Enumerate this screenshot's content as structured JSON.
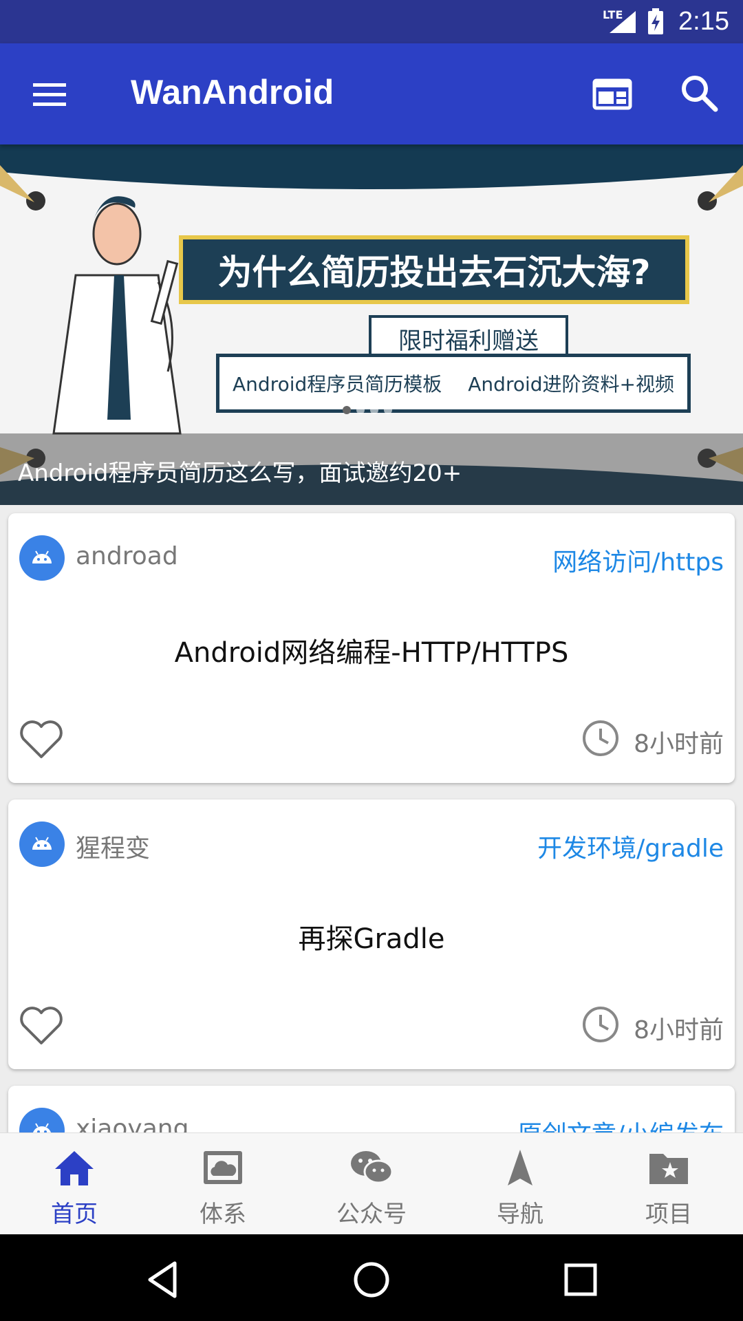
{
  "status_bar": {
    "network": "LTE",
    "time": "2:15"
  },
  "app_bar": {
    "title": "WanAndroid"
  },
  "banner": {
    "headline": "为什么简历投出去石沉大海?",
    "subheadline": "限时福利赠送",
    "tag_1": "Android程序员简历模板",
    "tag_2": "Android进阶资料+视频",
    "caption": "Android程序员简历这么写，面试邀约20+",
    "page_count": 4,
    "current_page": 1
  },
  "articles": [
    {
      "author": "androad",
      "category": "网络访问/https",
      "title": "Android网络编程-HTTP/HTTPS",
      "time": "8小时前",
      "liked": false
    },
    {
      "author": "猩程变",
      "category": "开发环境/gradle",
      "title": "再探Gradle",
      "time": "8小时前",
      "liked": false
    },
    {
      "author": "xiaoyang",
      "category": "原创文章/小编发布",
      "title": "",
      "time": "",
      "liked": false
    }
  ],
  "bottom_nav": {
    "items": [
      {
        "label": "首页",
        "icon": "home-icon",
        "active": true
      },
      {
        "label": "体系",
        "icon": "cloud-icon",
        "active": false
      },
      {
        "label": "公众号",
        "icon": "wechat-icon",
        "active": false
      },
      {
        "label": "导航",
        "icon": "navigation-icon",
        "active": false
      },
      {
        "label": "项目",
        "icon": "folder-star-icon",
        "active": false
      }
    ]
  },
  "colors": {
    "primary": "#2c40c5",
    "status_bar": "#2b3591",
    "accent_link": "#1e88e5",
    "avatar": "#3a82e6"
  }
}
